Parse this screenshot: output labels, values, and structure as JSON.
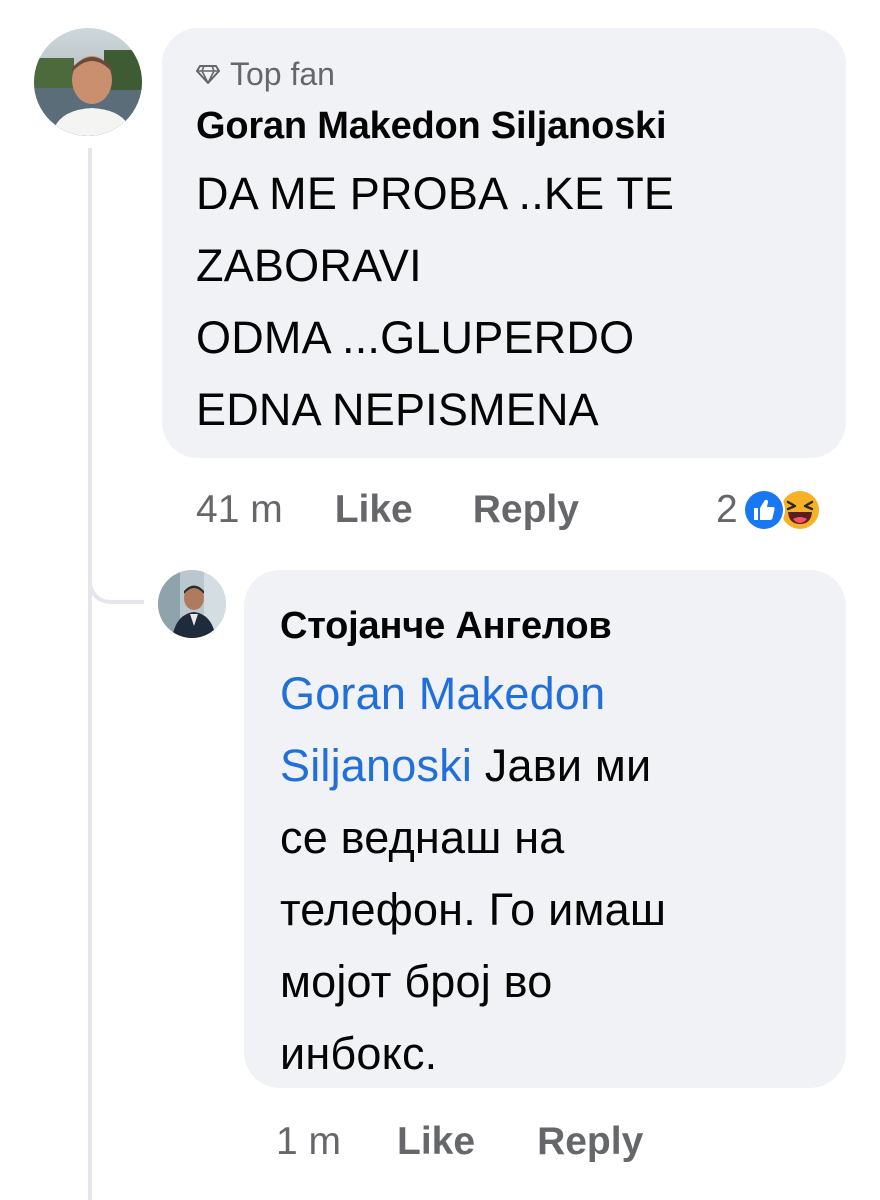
{
  "comment": {
    "badge": "Top fan",
    "author": "Goran Makedon Siljanoski",
    "lines": [
      "DA ME PROBA ..KE TE",
      "ZABORAVI",
      "ODMA ...GLUPERDO",
      "EDNA NEPISMENA"
    ],
    "time": "41 m",
    "like_label": "Like",
    "reply_label": "Reply",
    "reaction_count": "2",
    "reaction_icons": [
      "like-reaction",
      "haha-reaction"
    ]
  },
  "reply": {
    "author": "Стојанче Ангелов",
    "mention_line1": "Goran Makedon",
    "mention_line2": "Siljanoski",
    "line2_rest": " Јави ми",
    "lines": [
      "се веднаш на",
      "телефон. Го имаш",
      "мојот број во",
      "инбокс."
    ],
    "time": "1 m",
    "like_label": "Like",
    "reply_label": "Reply"
  },
  "colors": {
    "bubble": "#f0f2f5",
    "secondary_text": "#65676b",
    "mention": "#216fdb",
    "like_blue": "#1877f2",
    "haha_yellow": "#f7b125"
  }
}
